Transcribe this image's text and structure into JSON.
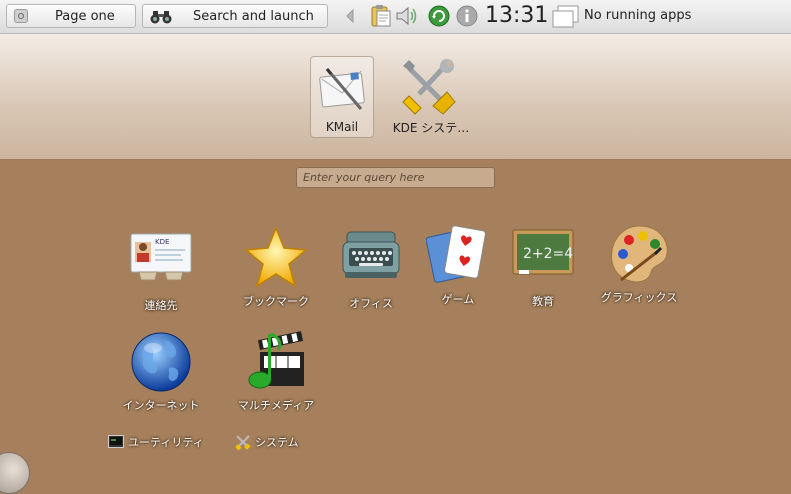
{
  "panel": {
    "page_button_label": "Page one",
    "search_button_label": "Search and launch",
    "clock": "13:31",
    "tasks_label": "No running apps"
  },
  "favorites": [
    {
      "label": "KMail",
      "icon": "mail-icon"
    },
    {
      "label": "KDE システ…",
      "icon": "tools-icon"
    }
  ],
  "search": {
    "placeholder": "Enter your query here"
  },
  "categories": [
    {
      "label": "連絡先",
      "icon": "contacts-icon"
    },
    {
      "label": "ブックマーク",
      "icon": "star-icon"
    },
    {
      "label": "オフィス",
      "icon": "typewriter-icon"
    },
    {
      "label": "ゲーム",
      "icon": "cards-icon"
    },
    {
      "label": "教育",
      "icon": "chalkboard-icon"
    },
    {
      "label": "グラフィックス",
      "icon": "palette-icon"
    },
    {
      "label": "インターネット",
      "icon": "globe-icon"
    },
    {
      "label": "マルチメディア",
      "icon": "multimedia-icon"
    }
  ],
  "small_items": [
    {
      "label": "ユーティリティ",
      "icon": "terminal-icon"
    },
    {
      "label": "システム",
      "icon": "tools-icon"
    }
  ],
  "contacts_card_text": "KDE"
}
